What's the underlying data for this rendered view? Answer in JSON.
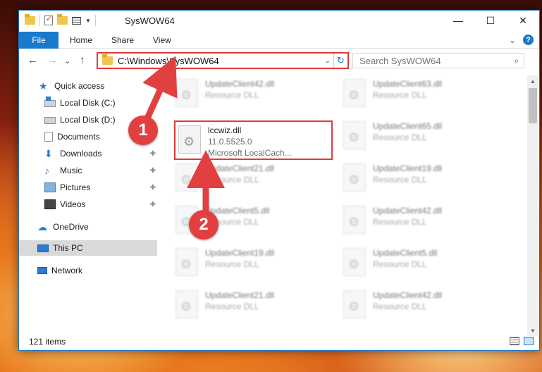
{
  "window": {
    "title": "SysWOW64",
    "controls": {
      "minimize": "—",
      "maximize": "☐",
      "close": "✕"
    }
  },
  "ribbon": {
    "file": "File",
    "tabs": [
      "Home",
      "Share",
      "View"
    ],
    "expand": "⌄",
    "help": "?"
  },
  "nav": {
    "back": "←",
    "forward": "→",
    "recent": "⌄",
    "up": "↑",
    "address": "C:\\Windows\\SysWOW64",
    "address_dropdown": "⌄",
    "refresh": "↻",
    "search_placeholder": "Search SysWOW64",
    "search_icon": "⌕"
  },
  "sidebar": {
    "items": [
      {
        "label": "Quick access",
        "icon": "star-icon",
        "pinned": false
      },
      {
        "label": "Local Disk (C:)",
        "icon": "drive-icon",
        "pinned": false
      },
      {
        "label": "Local Disk (D:)",
        "icon": "drive-icon",
        "pinned": false
      },
      {
        "label": "Documents",
        "icon": "documents-icon",
        "pinned": false
      },
      {
        "label": "Downloads",
        "icon": "download-icon",
        "pinned": true
      },
      {
        "label": "Music",
        "icon": "music-icon",
        "pinned": true
      },
      {
        "label": "Pictures",
        "icon": "pictures-icon",
        "pinned": true
      },
      {
        "label": "Videos",
        "icon": "videos-icon",
        "pinned": true
      },
      {
        "label": "OneDrive",
        "icon": "cloud-icon",
        "pinned": false
      },
      {
        "label": "This PC",
        "icon": "computer-icon",
        "pinned": false,
        "selected": true
      },
      {
        "label": "Network",
        "icon": "network-icon",
        "pinned": false
      }
    ],
    "pin_glyph": "📌"
  },
  "files": {
    "left": [
      {
        "name": "UpdateClient42.dll",
        "type": "Resource DLL"
      },
      {
        "name": "lccwiz.dll",
        "version": "11.0.5525.0",
        "company": "Microsoft LocalCach..."
      },
      {
        "name": "UpdateClient21.dll",
        "type": "Resource DLL"
      },
      {
        "name": "UpdateClient5.dll",
        "type": "Resource DLL"
      },
      {
        "name": "UpdateClient19.dll",
        "type": "Resource DLL"
      },
      {
        "name": "UpdateClient21.dll",
        "type": "Resource DLL"
      }
    ],
    "right": [
      {
        "name": "UpdateClient63.dll",
        "type": "Resource DLL"
      },
      {
        "name": "UpdateClient65.dll",
        "type": "Resource DLL"
      },
      {
        "name": "UpdateClient19.dll",
        "type": "Resource DLL"
      },
      {
        "name": "UpdateClient42.dll",
        "type": "Resource DLL"
      },
      {
        "name": "UpdateClient5.dll",
        "type": "Resource DLL"
      },
      {
        "name": "UpdateClient42.dll",
        "type": "Resource DLL"
      }
    ]
  },
  "status": {
    "count": "121 items"
  },
  "annotations": {
    "one": "1",
    "two": "2",
    "color": "#e24040"
  },
  "scrollbar": {
    "up": "▲",
    "down": "▼"
  }
}
